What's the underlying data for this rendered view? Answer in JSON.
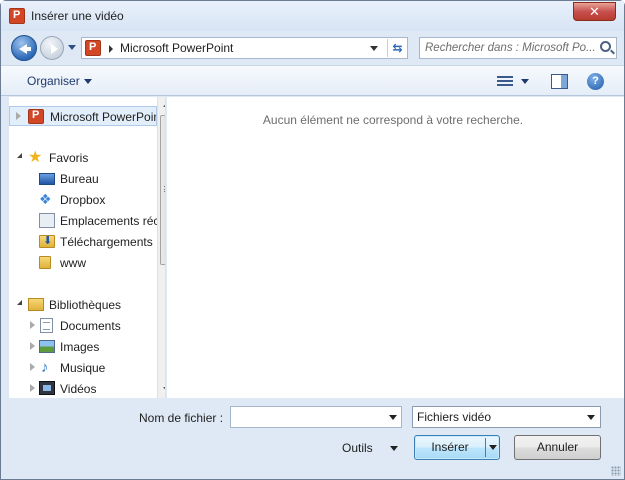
{
  "window": {
    "title": "Insérer une vidéo",
    "close_label": "✕"
  },
  "address_bar": {
    "path": "Microsoft PowerPoint",
    "refresh_icon": "refresh-icon"
  },
  "search": {
    "placeholder": "Rechercher dans : Microsoft Po..."
  },
  "toolbar": {
    "organise_label": "Organiser",
    "help_label": "?"
  },
  "nav": {
    "items": [
      {
        "label": "Microsoft PowerPoint",
        "icon": "powerpoint-icon"
      },
      {
        "label": "Favoris",
        "icon": "star-icon"
      },
      {
        "label": "Bureau",
        "icon": "desktop-icon"
      },
      {
        "label": "Dropbox",
        "icon": "dropbox-icon"
      },
      {
        "label": "Emplacements récents",
        "icon": "recent-places-icon"
      },
      {
        "label": "Téléchargements",
        "icon": "downloads-icon"
      },
      {
        "label": "www",
        "icon": "folder-icon"
      },
      {
        "label": "Bibliothèques",
        "icon": "library-icon"
      },
      {
        "label": "Documents",
        "icon": "documents-icon"
      },
      {
        "label": "Images",
        "icon": "pictures-icon"
      },
      {
        "label": "Musique",
        "icon": "music-icon"
      },
      {
        "label": "Vidéos",
        "icon": "videos-icon"
      }
    ]
  },
  "main": {
    "empty_message": "Aucun élément ne correspond à votre recherche."
  },
  "footer": {
    "filename_label": "Nom de fichier :",
    "filename_value": "",
    "filter_value": "Fichiers vidéo",
    "tools_label": "Outils",
    "insert_label": "Insérer",
    "cancel_label": "Annuler"
  }
}
